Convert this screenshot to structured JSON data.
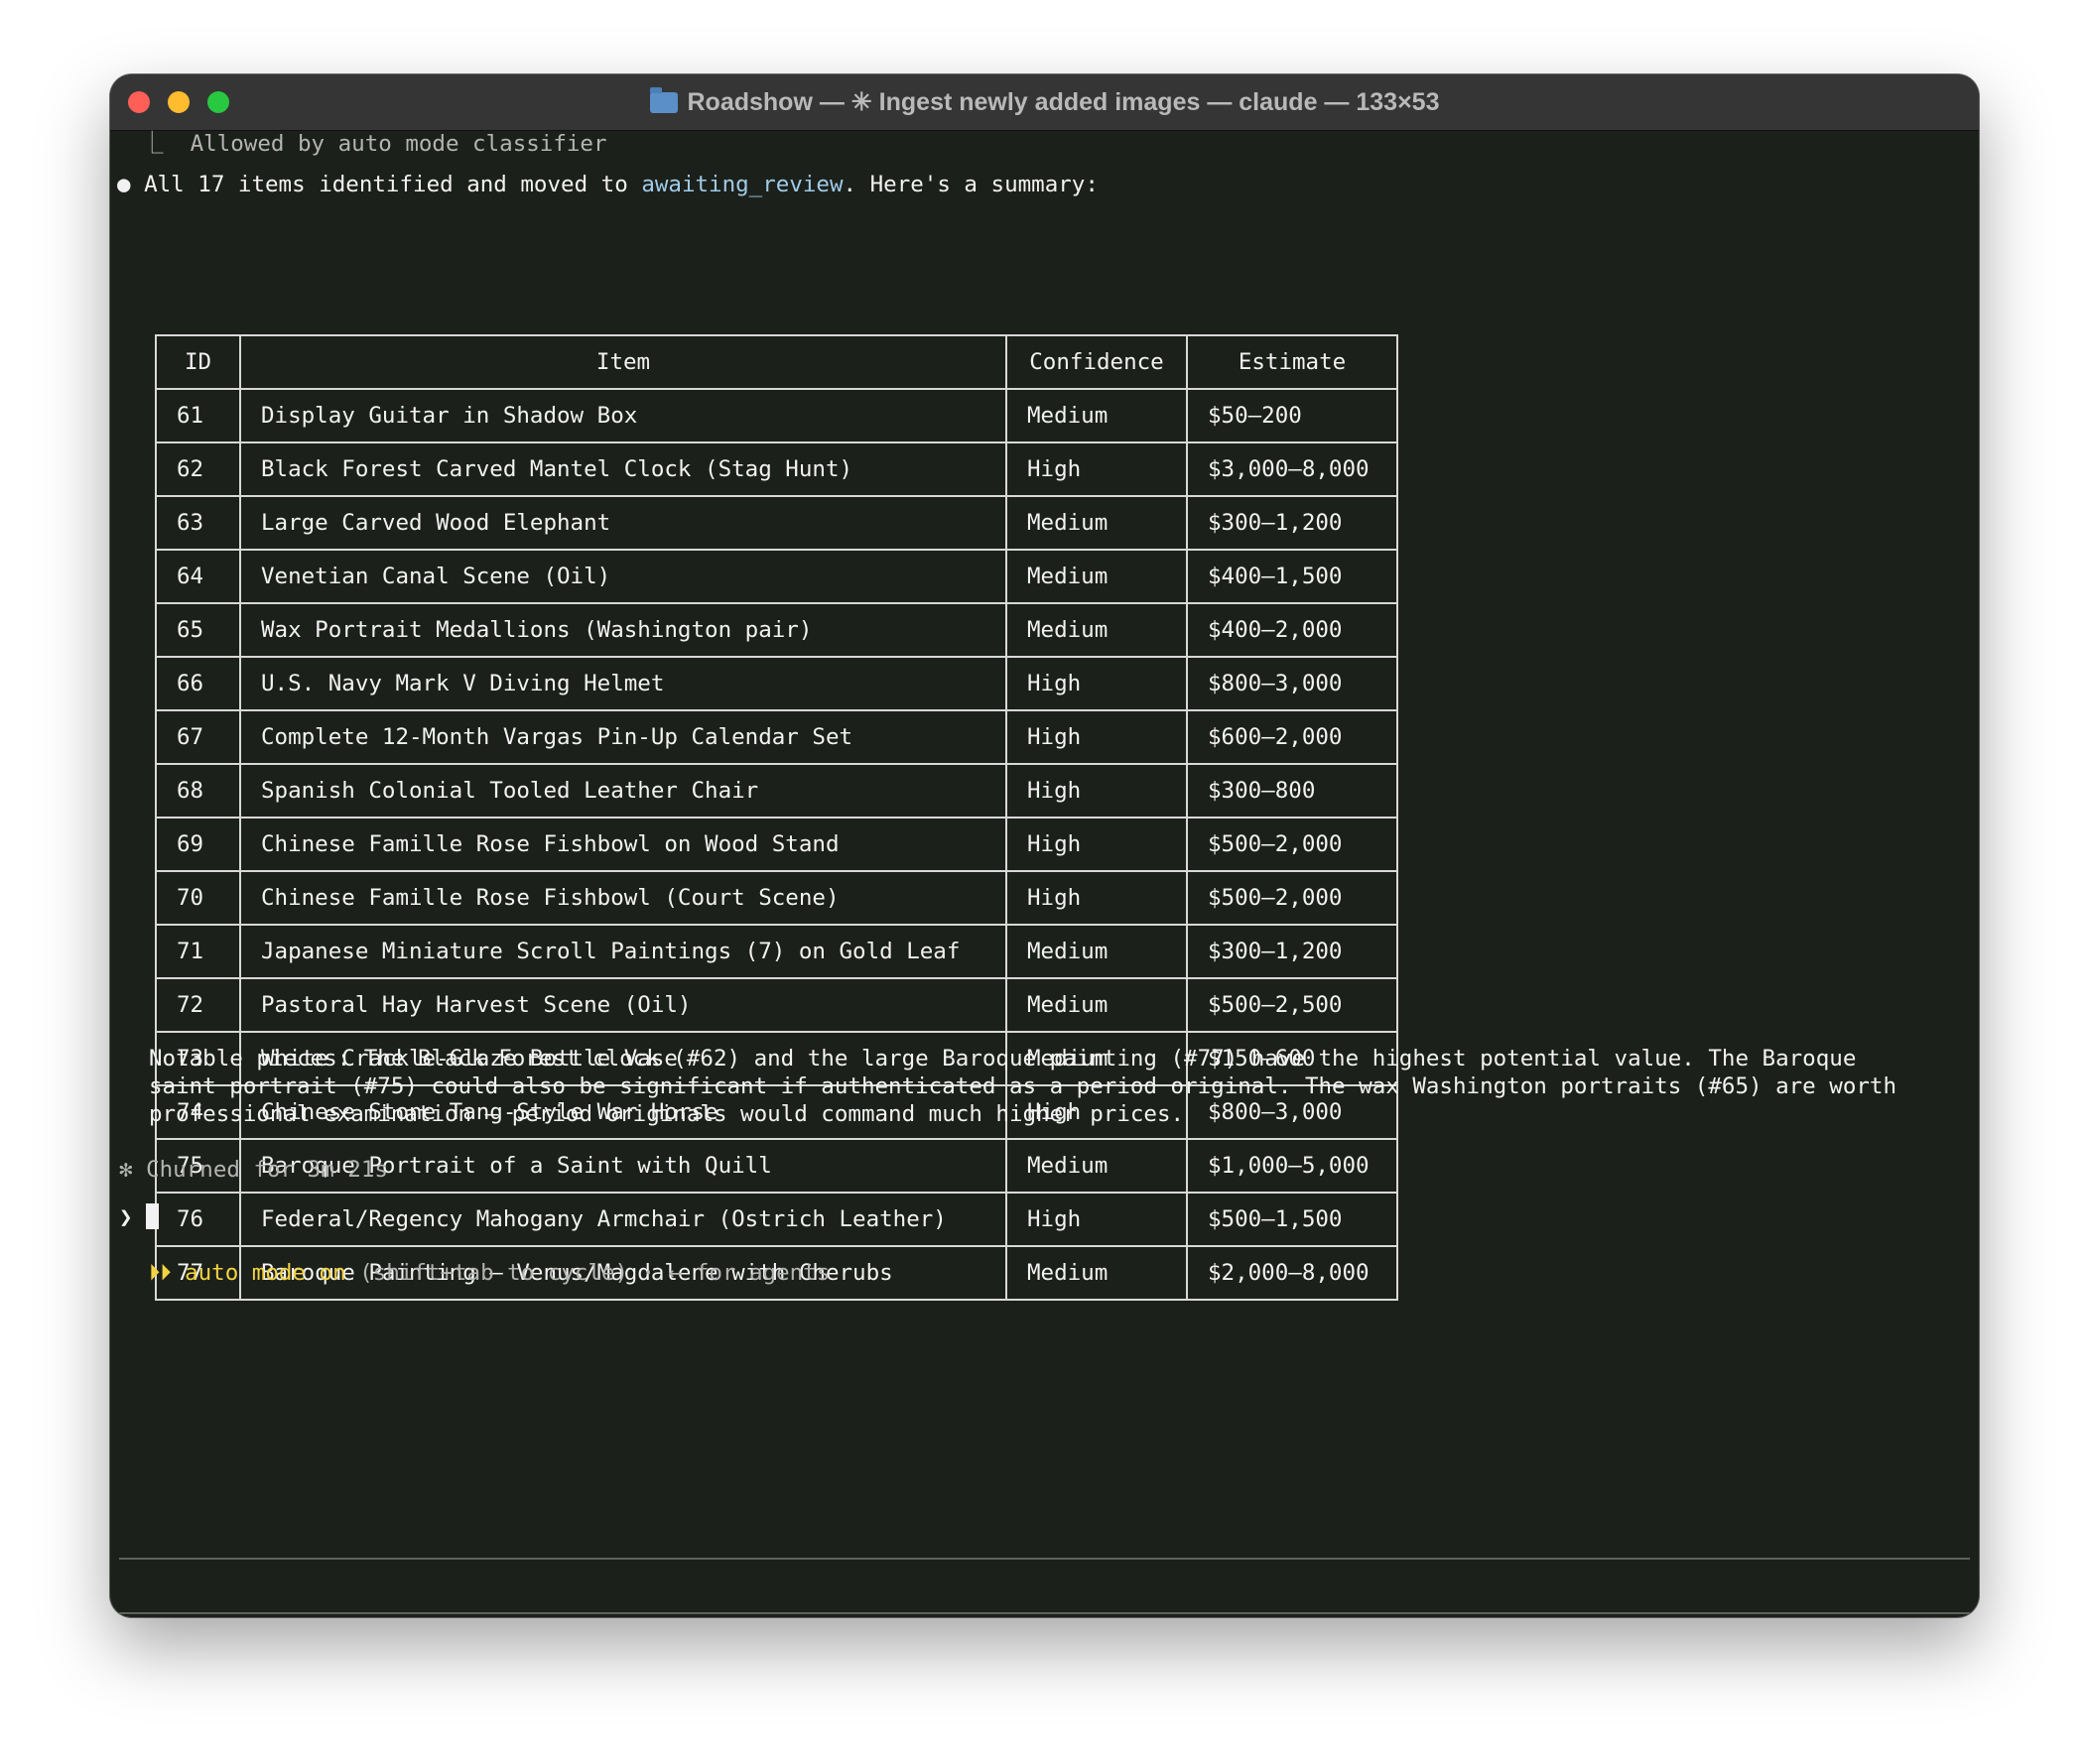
{
  "window": {
    "title": "Roadshow — ✳ Ingest newly added images — claude — 133×53"
  },
  "terminal": {
    "classifier_line": "⎿  Allowed by auto mode classifier",
    "summary_bullet": "●",
    "summary_prefix": "All 17 items identified and moved to ",
    "summary_link": "awaiting_review",
    "summary_suffix": ". Here's a summary:",
    "table": {
      "headers": [
        "ID",
        "Item",
        "Confidence",
        "Estimate"
      ],
      "rows": [
        [
          "61",
          "Display Guitar in Shadow Box",
          "Medium",
          "$50–200"
        ],
        [
          "62",
          "Black Forest Carved Mantel Clock (Stag Hunt)",
          "High",
          "$3,000–8,000"
        ],
        [
          "63",
          "Large Carved Wood Elephant",
          "Medium",
          "$300–1,200"
        ],
        [
          "64",
          "Venetian Canal Scene (Oil)",
          "Medium",
          "$400–1,500"
        ],
        [
          "65",
          "Wax Portrait Medallions (Washington pair)",
          "Medium",
          "$400–2,000"
        ],
        [
          "66",
          "U.S. Navy Mark V Diving Helmet",
          "High",
          "$800–3,000"
        ],
        [
          "67",
          "Complete 12-Month Vargas Pin-Up Calendar Set",
          "High",
          "$600–2,000"
        ],
        [
          "68",
          "Spanish Colonial Tooled Leather Chair",
          "High",
          "$300–800"
        ],
        [
          "69",
          "Chinese Famille Rose Fishbowl on Wood Stand",
          "High",
          "$500–2,000"
        ],
        [
          "70",
          "Chinese Famille Rose Fishbowl (Court Scene)",
          "High",
          "$500–2,000"
        ],
        [
          "71",
          "Japanese Miniature Scroll Paintings (7) on Gold Leaf",
          "Medium",
          "$300–1,200"
        ],
        [
          "72",
          "Pastoral Hay Harvest Scene (Oil)",
          "Medium",
          "$500–2,500"
        ],
        [
          "73",
          "White Crackle-Glaze Bottle Vase",
          "Medium",
          "$150–600"
        ],
        [
          "74",
          "Chinese Stone Tang-Style War Horse",
          "High",
          "$800–3,000"
        ],
        [
          "75",
          "Baroque Portrait of a Saint with Quill",
          "Medium",
          "$1,000–5,000"
        ],
        [
          "76",
          "Federal/Regency Mahogany Armchair (Ostrich Leather)",
          "High",
          "$500–1,500"
        ],
        [
          "77",
          "Baroque Painting – Venus/Magdalene with Cherubs",
          "Medium",
          "$2,000–8,000"
        ]
      ]
    },
    "notes": [
      "Notable pieces: The Black Forest clock (#62) and the large Baroque painting (#77) have the highest potential value. The Baroque",
      "saint portrait (#75) could also be significant if authenticated as a period original. The wax Washington portraits (#65) are worth",
      "professional examination – period originals would command much higher prices."
    ],
    "churn_status": "✻ Churned for 3m 21s",
    "prompt_symbol": "❯",
    "footer": {
      "arrows": "⏵⏵",
      "mode": "auto mode on",
      "hint": " (shift+tab to cycle) · ← for agents"
    }
  }
}
